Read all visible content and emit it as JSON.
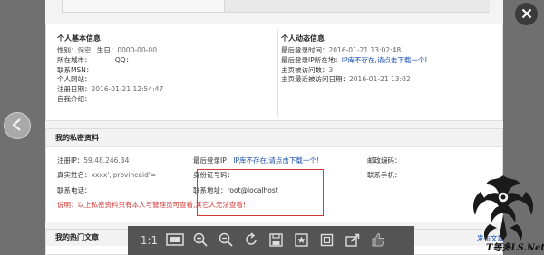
{
  "basic_info": {
    "title": "个人基本信息",
    "gender_label": "性别：",
    "gender_value": "保密",
    "birthday_label": "生日：",
    "birthday_value": "0000-00-00",
    "city_label": "所在城市：",
    "city_value": "",
    "qq_label": "QQ：",
    "qq_value": "",
    "msn_label": "联系MSN：",
    "msn_value": "",
    "website_label": "个人网站：",
    "website_value": "",
    "register_label": "注册日期：",
    "register_value": "2016-01-21 12:54:47",
    "intro_label": "自我介绍：",
    "intro_value": ""
  },
  "activity_info": {
    "title": "个人动态信息",
    "last_login_label": "最后登录时间：",
    "last_login_value": "2016-01-21 13:02:48",
    "last_ip_label": "最后登录IP所在地：",
    "last_ip_value": "IP库不存在,请点击下载一个!",
    "visits_label": "主页被访问数：",
    "visits_value": "3",
    "last_visit_label": "主页最近被访问日期：",
    "last_visit_value": "2016-01-21 13:02"
  },
  "private_info": {
    "title": "我的私密资料",
    "reg_ip_label": "注册IP：",
    "reg_ip_value": "59.48.246.34",
    "last_login_ip_label": "最后登录IP：",
    "last_login_ip_value": "IP库不存在,请点击下载一个!",
    "postcode_label": "邮政编码：",
    "realname_label": "真实姓名：",
    "realname_value": "xxxx','provinceid'=",
    "idcard_label": "身份证号码：",
    "mobile_label": "联系手机：",
    "phone_label": "联系电话：",
    "address_label": "联系地址：",
    "address_value": "root@localhost",
    "note_prefix": "说明：以上私密资料只有本人与管理员",
    "note_suffix": "可查看,其它人无法查看!"
  },
  "hot_articles": {
    "title": "我的热门文章",
    "publish_link": "发布文章"
  },
  "toolbar": {
    "ratio_label": "1:1"
  },
  "watermark": {
    "text": "T等多LS.Net"
  }
}
